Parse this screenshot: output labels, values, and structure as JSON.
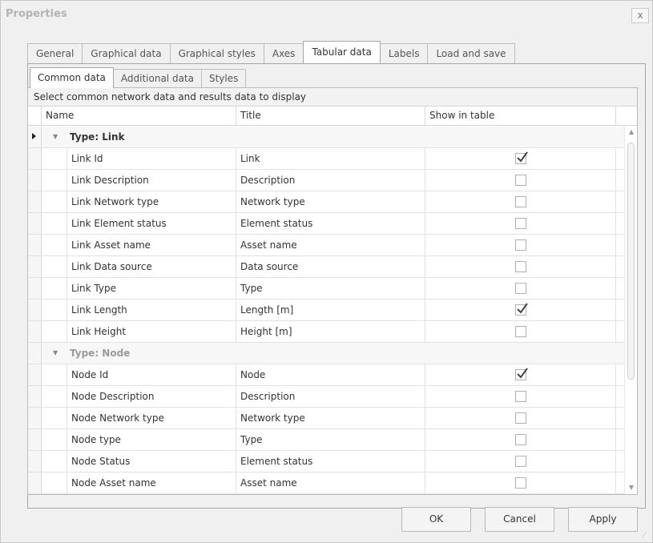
{
  "window": {
    "title": "Properties",
    "close_label": "x"
  },
  "outer_tabs": [
    {
      "label": "General",
      "active": false
    },
    {
      "label": "Graphical data",
      "active": false
    },
    {
      "label": "Graphical styles",
      "active": false
    },
    {
      "label": "Axes",
      "active": false
    },
    {
      "label": "Tabular data",
      "active": true
    },
    {
      "label": "Labels",
      "active": false
    },
    {
      "label": "Load and save",
      "active": false
    }
  ],
  "inner_tabs": [
    {
      "label": "Common data",
      "active": true
    },
    {
      "label": "Additional data",
      "active": false
    },
    {
      "label": "Styles",
      "active": false
    }
  ],
  "grid": {
    "group_panel_caption": "Select common network data and results data to display",
    "columns": {
      "name": "Name",
      "title": "Title",
      "show": "Show in table"
    },
    "groups": [
      {
        "label": "Type: Link",
        "focused": true,
        "rows": [
          {
            "name": "Link Id",
            "title": "Link",
            "show": true
          },
          {
            "name": "Link Description",
            "title": "Description",
            "show": false
          },
          {
            "name": "Link Network type",
            "title": "Network type",
            "show": false
          },
          {
            "name": "Link Element status",
            "title": "Element status",
            "show": false
          },
          {
            "name": "Link Asset name",
            "title": "Asset name",
            "show": false
          },
          {
            "name": "Link Data source",
            "title": "Data source",
            "show": false
          },
          {
            "name": "Link Type",
            "title": "Type",
            "show": false
          },
          {
            "name": "Link Length",
            "title": "Length [m]",
            "show": true
          },
          {
            "name": "Link Height",
            "title": "Height [m]",
            "show": false
          }
        ]
      },
      {
        "label": "Type: Node",
        "focused": false,
        "rows": [
          {
            "name": "Node Id",
            "title": "Node",
            "show": true
          },
          {
            "name": "Node Description",
            "title": "Description",
            "show": false
          },
          {
            "name": "Node Network type",
            "title": "Network type",
            "show": false
          },
          {
            "name": "Node type",
            "title": "Type",
            "show": false
          },
          {
            "name": "Node Status",
            "title": "Element status",
            "show": false
          },
          {
            "name": "Node Asset name",
            "title": "Asset name",
            "show": false
          }
        ]
      }
    ]
  },
  "buttons": {
    "ok": "OK",
    "cancel": "Cancel",
    "apply": "Apply"
  }
}
